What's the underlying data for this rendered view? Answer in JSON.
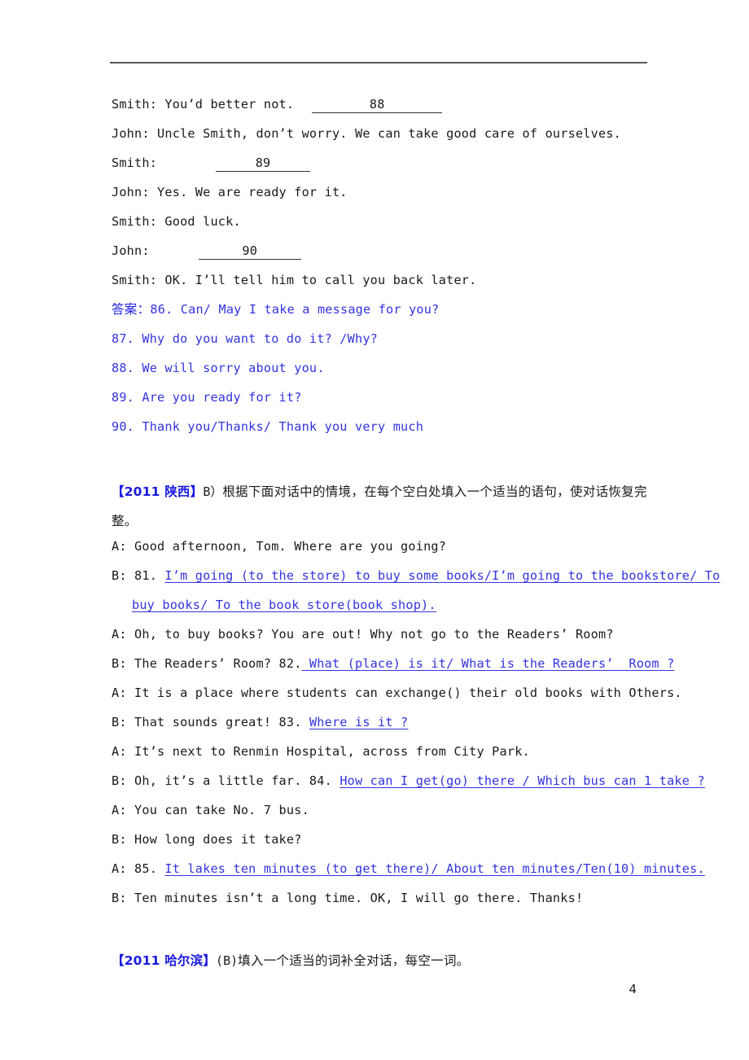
{
  "document": {
    "page_number": "4",
    "colors": {
      "text": "#1a1a1a",
      "answer_blue": "#3333e0",
      "heading_blue": "#1a1ae0",
      "rule": "#5a5a5a"
    }
  },
  "top_dialogue": {
    "lines": [
      {
        "speaker": "Smith: You’d better not.",
        "blank": "88"
      },
      {
        "text": "John: Uncle Smith, don’t worry. We can take good care of ourselves."
      },
      {
        "speaker": "Smith:",
        "blank": "89"
      },
      {
        "text": "John: Yes. We are ready for it."
      },
      {
        "text": "Smith: Good luck."
      },
      {
        "speaker": "John:",
        "blank": "90"
      },
      {
        "text": "Smith: OK. I’ll tell him to call you back later."
      }
    ]
  },
  "answers": {
    "label": "答案：",
    "items": [
      "86. Can/ May I take a message for you?",
      "87. Why do you want to do it? /Why?",
      "88. We will sorry about you.",
      "89. Are you ready for it?",
      "90. Thank you/Thanks/ Thank you very much"
    ]
  },
  "shaanxi_section": {
    "tag": "【2011 陕西】",
    "instruction_latin": "B）",
    "instruction_cjk": "根据下面对话中的情境，在每个空白处填入一个适当的语句，使对话恢复完整。",
    "dialogue": [
      {
        "prefix": "A: Good afternoon, Tom. Where are you going?",
        "answer": ""
      },
      {
        "prefix": "B: 81. ",
        "answer": "I’m going (to the store) to buy some books/I’m going to the bookstore/ To",
        "answer_cont": "buy books/ To the book store(book shop)."
      },
      {
        "prefix": "A: Oh, to buy books? You are out! Why not go to the Readers’ Room?",
        "answer": ""
      },
      {
        "prefix": "B: The Readers’ Room? 82.",
        "answer": " What (place) is it/ What is the Readers’  Room ?"
      },
      {
        "prefix": "A: It is a place where students can exchange() their old books with Others.",
        "answer": ""
      },
      {
        "prefix": "B: That sounds great! 83. ",
        "answer": "Where is it ?"
      },
      {
        "prefix": "A: It’s next to Renmin Hospital, across from City Park.",
        "answer": ""
      },
      {
        "prefix": "B: Oh, it’s a little far. 84. ",
        "answer": "How can I get(go) there / Which bus can 1 take ?"
      },
      {
        "prefix": "A: You can take No. 7 bus.",
        "answer": ""
      },
      {
        "prefix": "B: How long does it take?",
        "answer": ""
      },
      {
        "prefix": "A: 85. ",
        "answer": "It lakes ten minutes (to get there)/ About ten minutes/Ten(10) minutes."
      },
      {
        "prefix": "B: Ten minutes isn’t a long time. OK, I will go there. Thanks!",
        "answer": ""
      }
    ]
  },
  "harbin_section": {
    "tag": "【2011 哈尔滨】",
    "instruction_latin": "(B)",
    "instruction_cjk": "填入一个适当的词补全对话，每空一词。"
  }
}
